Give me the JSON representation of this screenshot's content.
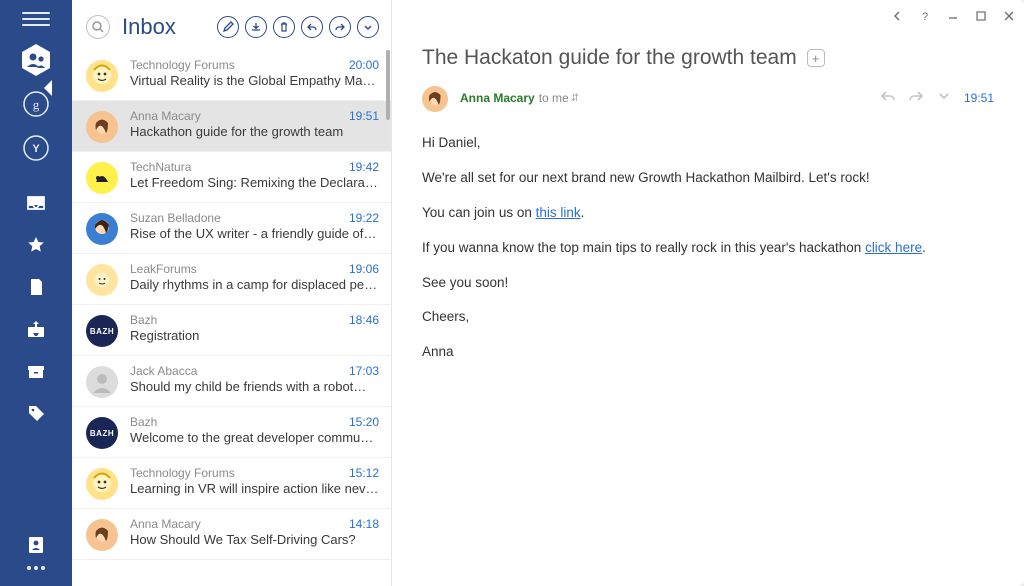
{
  "rail": {
    "accounts": [
      "people",
      "google",
      "yahoo"
    ]
  },
  "folder": {
    "title": "Inbox"
  },
  "messages": [
    {
      "sender": "Technology Forums",
      "subject": "Virtual Reality is the Global Empathy Ma…",
      "time": "20:00",
      "avatar": "tf"
    },
    {
      "sender": "Anna Macary",
      "subject": "Hackathon guide for the growth team",
      "time": "19:51",
      "avatar": "anna",
      "selected": true
    },
    {
      "sender": "TechNatura",
      "subject": "Let Freedom Sing: Remixing the Declarati…",
      "time": "19:42",
      "avatar": "tn"
    },
    {
      "sender": "Suzan Belladone",
      "subject": "Rise of the UX writer - a friendly guide of…",
      "time": "19:22",
      "avatar": "sb"
    },
    {
      "sender": "LeakForums",
      "subject": "Daily rhythms in a camp for displaced pe…",
      "time": "19:06",
      "avatar": "lf"
    },
    {
      "sender": "Bazh",
      "subject": "Registration",
      "time": "18:46",
      "avatar": "bazh"
    },
    {
      "sender": "Jack Abacca",
      "subject": "Should my child be friends with a robot…",
      "time": "17:03",
      "avatar": "ja"
    },
    {
      "sender": "Bazh",
      "subject": "Welcome to the great developer commu…",
      "time": "15:20",
      "avatar": "bazh"
    },
    {
      "sender": "Technology Forums",
      "subject": "Learning in VR will inspire action like nev…",
      "time": "15:12",
      "avatar": "tf"
    },
    {
      "sender": "Anna Macary",
      "subject": "How Should We Tax Self-Driving Cars?",
      "time": "14:18",
      "avatar": "anna"
    }
  ],
  "mail": {
    "subject": "The Hackaton guide for the growth team",
    "from": "Anna Macary",
    "to": "to me",
    "time": "19:51",
    "body_greeting": "Hi Daniel,",
    "body_p1": "We're all set for our next brand new Growth Hackathon Mailbird. Let's rock!",
    "body_p2a": "You can join us on ",
    "body_p2_link": "this link",
    "body_p2b": ".",
    "body_p3a": "If you wanna know the top main tips to really rock in this year's hackathon ",
    "body_p3_link": "click here",
    "body_p3b": ".",
    "body_p4": "See you soon!",
    "body_p5": "Cheers,",
    "body_p6": "Anna"
  },
  "bazh_label": "BAZH"
}
